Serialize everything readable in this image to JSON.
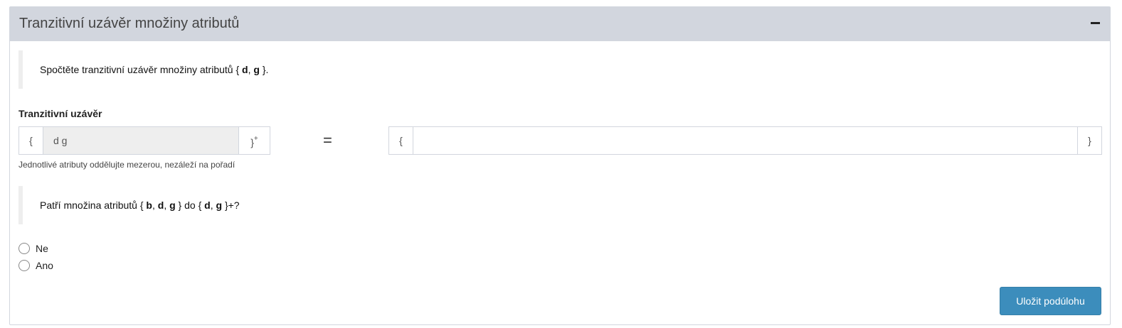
{
  "panel": {
    "title": "Tranzitivní uzávěr množiny atributů"
  },
  "task": {
    "prefix": "Spočtěte tranzitivní uzávěr množiny atributů { ",
    "attr1": "d",
    "sep1": ", ",
    "attr2": "g",
    "suffix": " }."
  },
  "closure": {
    "label": "Tranzitivní uzávěr",
    "open_brace": "{",
    "close_brace": "}",
    "plus_sup": "+",
    "input_value": "d g",
    "equals": "=",
    "result_open_brace": "{",
    "result_close_brace": "}",
    "result_value": "",
    "help_text": "Jednotlivé atributy oddělujte mezerou, nezáleží na pořadí"
  },
  "question": {
    "prefix": "Patří množina atributů { ",
    "a1": "b",
    "s1": ", ",
    "a2": "d",
    "s2": ", ",
    "a3": "g",
    "mid": " } do { ",
    "b1": "d",
    "s3": ", ",
    "b2": "g",
    "suffix": " }+?"
  },
  "options": [
    {
      "label": "Ne",
      "selected": false
    },
    {
      "label": "Ano",
      "selected": false
    }
  ],
  "actions": {
    "save_label": "Uložit podúlohu"
  }
}
